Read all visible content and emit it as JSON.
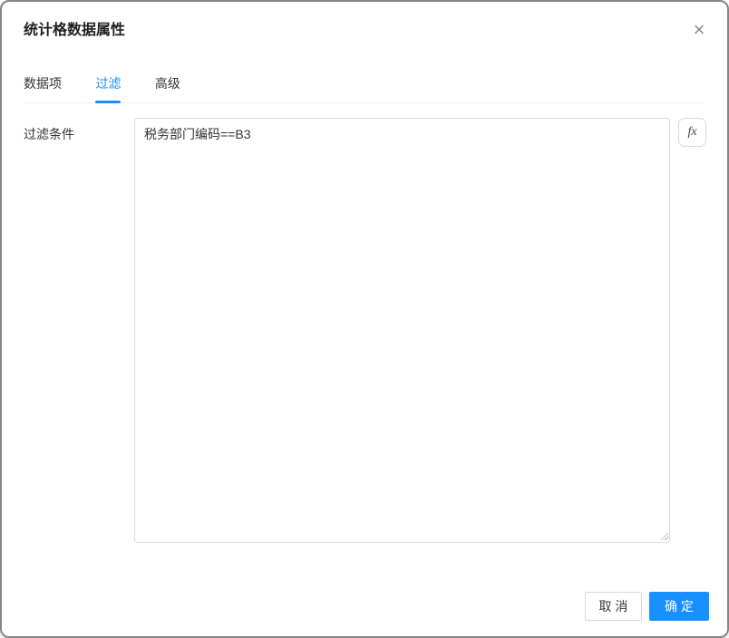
{
  "dialog": {
    "title": "统计格数据属性",
    "close_icon": "×"
  },
  "tabs": [
    {
      "label": "数据项",
      "active": false
    },
    {
      "label": "过滤",
      "active": true
    },
    {
      "label": "高级",
      "active": false
    }
  ],
  "form": {
    "filter_label": "过滤条件",
    "filter_value": "税务部门编码==B3",
    "fx_button_label": "fx"
  },
  "footer": {
    "cancel_label": "取 消",
    "ok_label": "确 定"
  },
  "colors": {
    "accent": "#1890ff",
    "input_border": "#d9d9d9",
    "tab_divider": "#f0f0f0",
    "text": "#333333",
    "muted_icon": "#8c8c8c"
  }
}
